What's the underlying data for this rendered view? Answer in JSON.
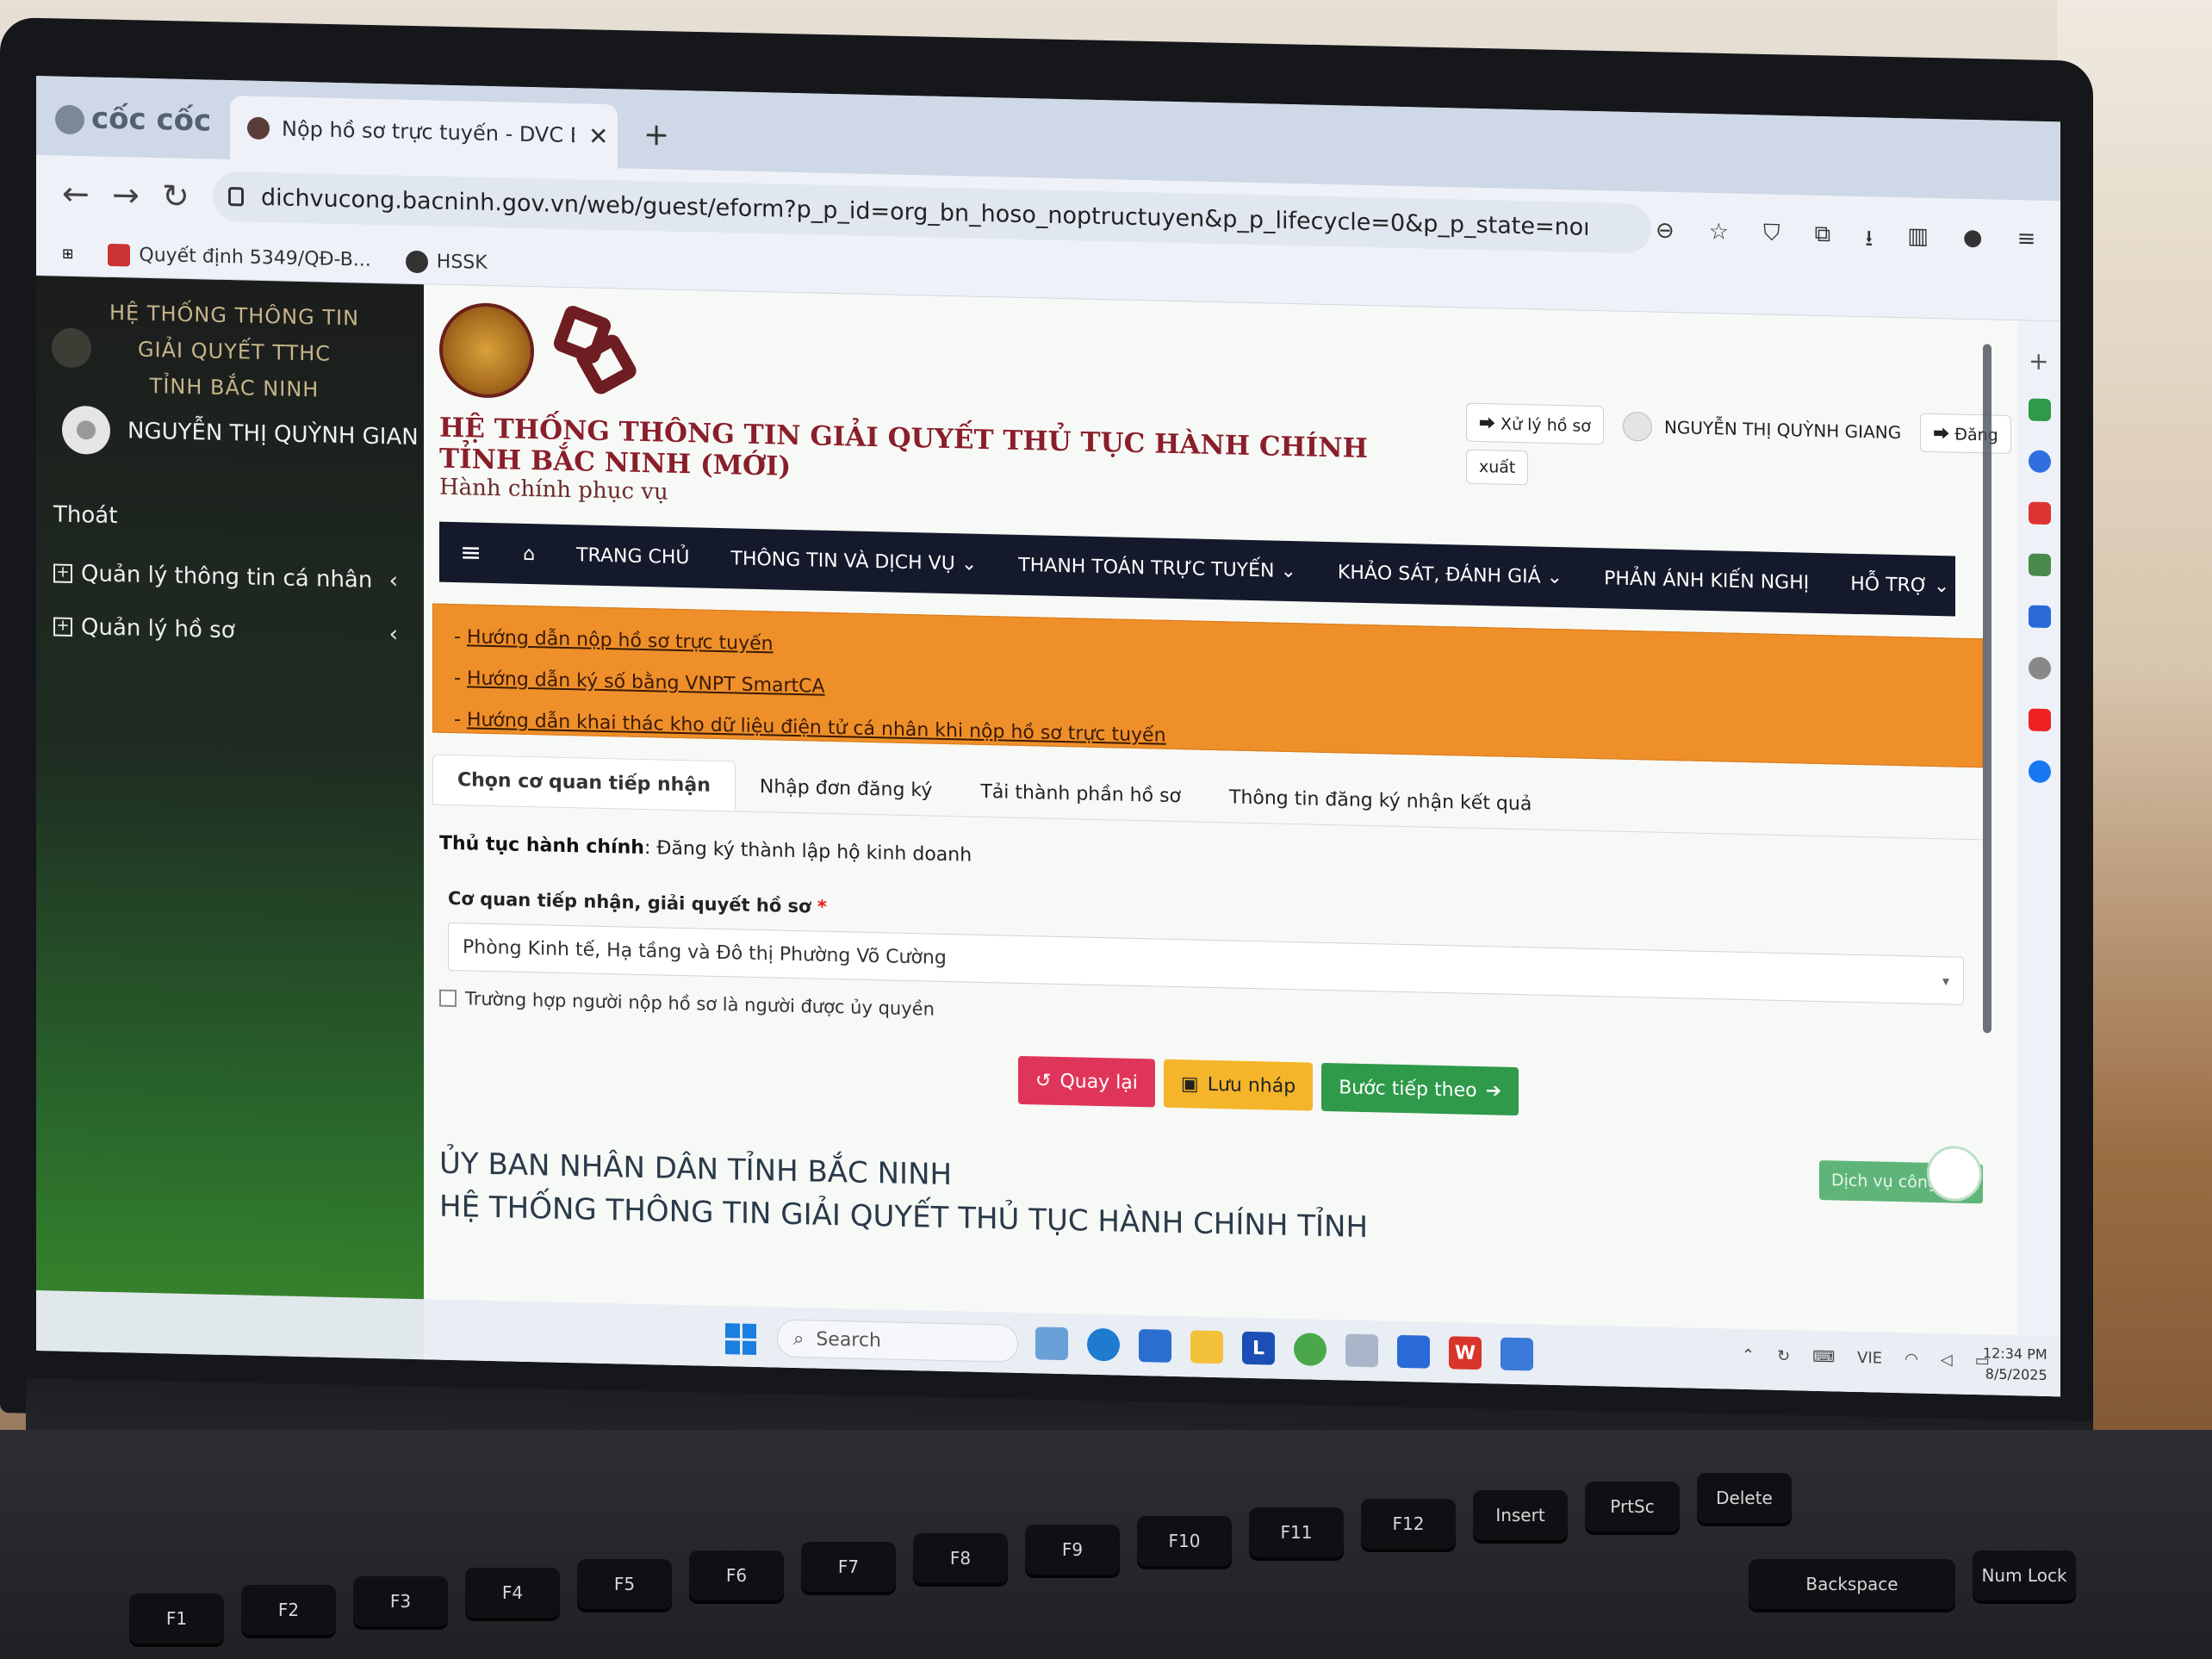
{
  "browser": {
    "brand": "cốc cốc",
    "tab_title": "Nộp hồ sơ trực tuyến - DVC B",
    "tab_close": "✕",
    "new_tab": "+",
    "url": "dichvucong.bacninh.gov.vn/web/guest/eform?p_p_id=org_bn_hoso_noptructuyen&p_p_lifecycle=0&p_p_state=normal&p_p_mode=view...",
    "bookmarks": [
      "Quyết định 5349/QĐ-B...",
      "HSSK"
    ]
  },
  "sidebar": {
    "title_lines": [
      "HỆ THỐNG THÔNG TIN",
      "GIẢI QUYẾT TTHC",
      "TỈNH BẮC NINH"
    ],
    "user_name": "NGUYỄN THỊ QUỲNH GIAN",
    "logout": "Thoát",
    "items": [
      {
        "label": "Quản lý thông tin cá nhân"
      },
      {
        "label": "Quản lý hồ sơ"
      }
    ]
  },
  "header": {
    "title_line1": "HỆ THỐNG THÔNG TIN GIẢI QUYẾT THỦ TỤC HÀNH CHÍNH",
    "title_line2": "TỈNH BẮC NINH (MỚI)",
    "subtitle": "Hành chính phục vụ",
    "process_button": "Xử lý hồ sơ",
    "user_name": "NGUYỄN THỊ QUỲNH GIANG",
    "logout_part1": "Đăng",
    "logout_part2": "xuất"
  },
  "nav": {
    "home": "TRANG CHỦ",
    "items": [
      "THÔNG TIN VÀ DỊCH VỤ",
      "THANH TOÁN TRỰC TUYẾN",
      "KHẢO SÁT, ĐÁNH GIÁ",
      "PHẢN ÁNH KIẾN NGHỊ",
      "HỖ TRỢ"
    ]
  },
  "notice": {
    "links": [
      "Hướng dẫn nộp hồ sơ trực tuyến",
      "Hướng dẫn ký số bằng VNPT SmartCA",
      "Hướng dẫn khai thác kho dữ liệu điện tử cá nhân khi nộp hồ sơ trực tuyến"
    ]
  },
  "form": {
    "tabs": [
      "Chọn cơ quan tiếp nhận",
      "Nhập đơn đăng ký",
      "Tải thành phần hồ sơ",
      "Thông tin đăng ký nhận kết quả"
    ],
    "procedure_label": "Thủ tục hành chính",
    "procedure_value": "Đăng ký thành lập hộ kinh doanh",
    "agency_label": "Cơ quan tiếp nhận, giải quyết hồ sơ",
    "agency_required": "*",
    "agency_value": "Phòng Kinh tế, Hạ tầng và Đô thị Phường Võ Cường",
    "proxy_label": "Trường hợp người nộp hồ sơ là người được ủy quyền",
    "back_button": "Quay lại",
    "draft_button": "Lưu nháp",
    "next_button": "Bước tiếp theo"
  },
  "footer": {
    "line1": "ỦY BAN NHÂN DÂN TỈNH BẮC NINH",
    "line2": "HỆ THỐNG THÔNG TIN GIẢI QUYẾT THỦ TỤC HÀNH CHÍNH TỈNH",
    "service_button": "Dịch vụ công"
  },
  "taskbar": {
    "search": "Search",
    "lang": "VIE",
    "time": "12:34 PM",
    "date": "8/5/2025"
  },
  "keyboard": [
    "F1",
    "F2",
    "F3",
    "F4",
    "F5",
    "F6",
    "F7",
    "F8",
    "F9",
    "F10",
    "F11",
    "F12",
    "Insert",
    "PrtSc",
    "Delete",
    "Backspace",
    "Num Lock"
  ],
  "colors": {
    "notice_bg": "#ef8f2a",
    "nav_bg": "#141a2b",
    "title_red": "#8a1e2b",
    "btn_back": "#e0355a",
    "btn_draft": "#f4b52a",
    "btn_next": "#2e9a4a"
  }
}
